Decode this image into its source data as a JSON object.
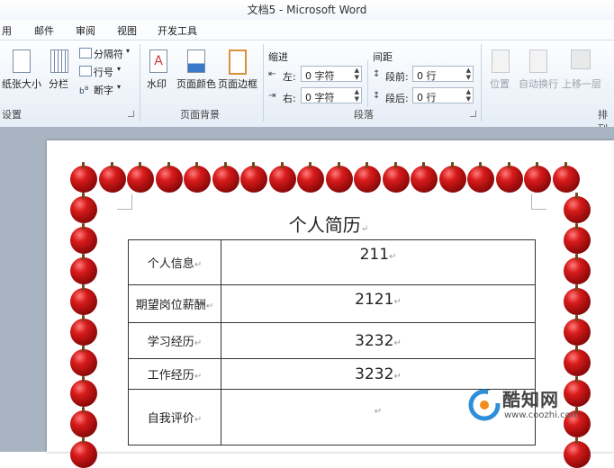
{
  "window": {
    "title": "文档5 - Microsoft Word"
  },
  "tabs": [
    "用",
    "邮件",
    "审阅",
    "视图",
    "开发工具"
  ],
  "ribbon": {
    "page_setup": {
      "paper_size": "纸张大小",
      "columns": "分栏",
      "breaks": "分隔符",
      "line_numbers": "行号",
      "hyphenation": "断字",
      "group_label": "设置"
    },
    "page_background": {
      "watermark": "水印",
      "page_color": "页面颜色",
      "page_borders": "页面边框",
      "group_label": "页面背景"
    },
    "paragraph": {
      "indent_header": "缩进",
      "indent_left_label": "左:",
      "indent_left_value": "0 字符",
      "indent_right_label": "右:",
      "indent_right_value": "0 字符",
      "spacing_header": "间距",
      "before_label": "段前:",
      "before_value": "0 行",
      "after_label": "段后:",
      "after_value": "0 行",
      "group_label": "段落"
    },
    "arrange": {
      "position": "位置",
      "wrap_text": "自动换行",
      "bring_forward": "上移一层",
      "group_label": "排列"
    }
  },
  "document": {
    "title": "个人简历",
    "rows": [
      {
        "label": "个人信息",
        "value": "211"
      },
      {
        "label": "期望岗位薪酬",
        "value": "2121"
      },
      {
        "label": "学习经历",
        "value": "3232"
      },
      {
        "label": "工作经历",
        "value": "3232"
      },
      {
        "label": "自我评价",
        "value": ""
      }
    ]
  },
  "watermark": {
    "brand": "酷知网",
    "url": "www.coozhi.com"
  },
  "colors": {
    "apple": "#c0151a",
    "ribbon_bg": "#e6edf6",
    "doc_bg": "#a9b4c2"
  }
}
